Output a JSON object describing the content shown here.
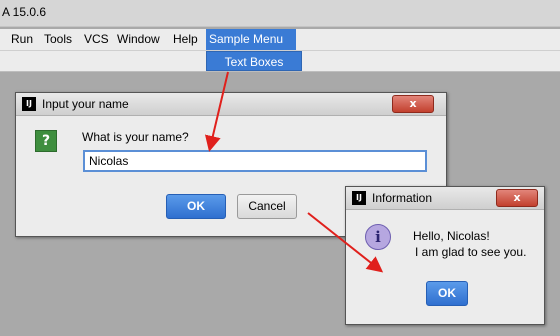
{
  "window": {
    "title": "A 15.0.6"
  },
  "menubar": {
    "items": [
      "Run",
      "Tools",
      "VCS",
      "Window",
      "Help",
      "Sample Menu"
    ]
  },
  "dropdown": {
    "item": "Text Boxes"
  },
  "input_dialog": {
    "title": "Input your name",
    "close_glyph": "x",
    "prompt": "What is your name?",
    "value": "Nicolas",
    "ok_label": "OK",
    "cancel_label": "Cancel",
    "icon_glyph": "?"
  },
  "info_dialog": {
    "title": "Information",
    "close_glyph": "x",
    "message_line1": "Hello, Nicolas!",
    "message_line2": "I am glad to see you.",
    "ok_label": "OK",
    "icon_glyph": "i"
  },
  "app_icon_text": "IJ",
  "colors": {
    "accent": "#3a7bd5",
    "annotation_arrow": "#e0201c",
    "close_button": "#c2402e"
  }
}
